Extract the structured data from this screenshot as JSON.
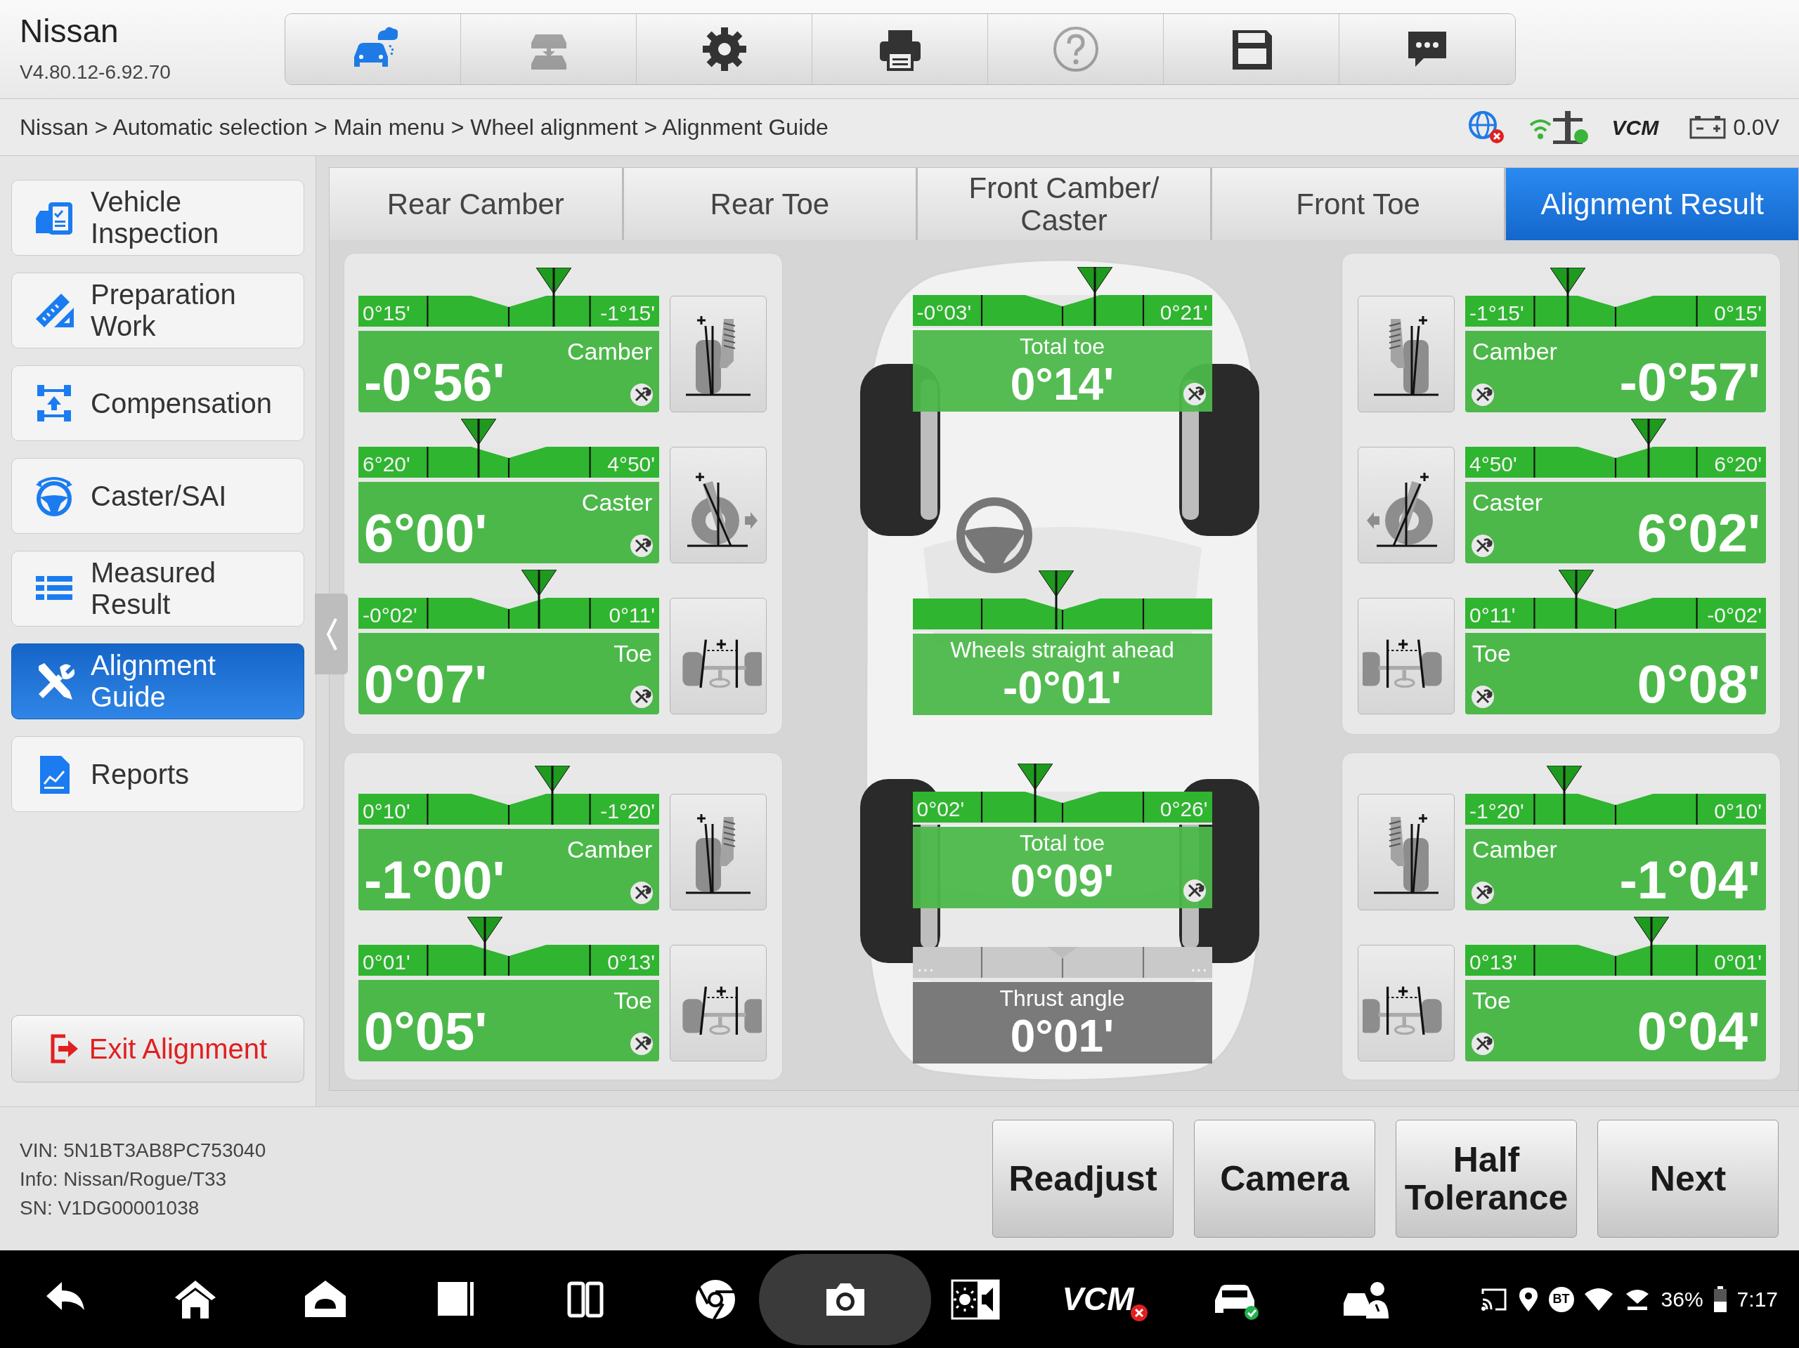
{
  "app": {
    "title": "Nissan",
    "version": "V4.80.12-6.92.70"
  },
  "toolbar": [
    {
      "kind": "car-cloud",
      "active": true,
      "disabled": false
    },
    {
      "kind": "car-lift",
      "active": false,
      "disabled": true
    },
    {
      "kind": "gear",
      "active": false,
      "disabled": false
    },
    {
      "kind": "printer",
      "active": false,
      "disabled": false
    },
    {
      "kind": "help",
      "active": false,
      "disabled": true
    },
    {
      "kind": "save",
      "active": false,
      "disabled": false
    },
    {
      "kind": "chat",
      "active": false,
      "disabled": false
    }
  ],
  "breadcrumb": "Nissan > Automatic selection > Main menu > Wheel alignment > Alignment Guide",
  "status": {
    "vcm_label": "VCM",
    "voltage": "0.0V"
  },
  "sidebar": {
    "items": [
      {
        "kind": "inspection",
        "label": "Vehicle Inspection",
        "selected": false
      },
      {
        "kind": "ruler",
        "label": "Preparation Work",
        "selected": false
      },
      {
        "kind": "compensation",
        "label": "Compensation",
        "selected": false
      },
      {
        "kind": "steering",
        "label": "Caster/SAI",
        "selected": false
      },
      {
        "kind": "list",
        "label": "Measured Result",
        "selected": false
      },
      {
        "kind": "tools",
        "label": "Alignment Guide",
        "selected": true
      },
      {
        "kind": "report",
        "label": "Reports",
        "selected": false
      }
    ],
    "exit_button": "Exit Alignment"
  },
  "tabs": [
    {
      "label": "Rear Camber",
      "selected": false
    },
    {
      "label": "Rear Toe",
      "selected": false
    },
    {
      "label": "Front Camber/ Caster",
      "selected": false
    },
    {
      "label": "Front Toe",
      "selected": false
    },
    {
      "label": "Alignment Result",
      "selected": true
    }
  ],
  "front_left": [
    {
      "kind": "camber",
      "label": "Camber",
      "value": "-0°56'",
      "left_reading": "0°15'",
      "right_reading": "-1°15'",
      "level": 0.65
    },
    {
      "kind": "caster",
      "label": "Caster",
      "value": "6°00'",
      "left_reading": "6°20'",
      "right_reading": "4°50'",
      "level": 0.4
    },
    {
      "kind": "toe",
      "label": "Toe",
      "value": "0°07'",
      "left_reading": "-0°02'",
      "right_reading": "0°11'",
      "level": 0.6
    }
  ],
  "rear_left": [
    {
      "kind": "camber",
      "label": "Camber",
      "value": "-1°00'",
      "left_reading": "0°10'",
      "right_reading": "-1°20'",
      "level": 0.645
    },
    {
      "kind": "toe",
      "label": "Toe",
      "value": "0°05'",
      "left_reading": "0°01'",
      "right_reading": "0°13'",
      "level": 0.42
    }
  ],
  "center": [
    {
      "kind": "active",
      "label": "Total toe",
      "value": "0°14'",
      "left_reading": "-0°03'",
      "right_reading": "0°21'",
      "level": 0.61,
      "adjustable": true
    },
    {
      "kind": "active",
      "label": "Wheels straight ahead",
      "value": "-0°01'",
      "level": 0.48,
      "adjustable": false
    },
    {
      "kind": "active",
      "label": "Total toe",
      "value": "0°09'",
      "left_reading": "0°02'",
      "right_reading": "0°26'",
      "level": 0.41,
      "adjustable": true
    },
    {
      "kind": "inactive",
      "label": "Thrust angle",
      "value": "0°01'",
      "left_reading": "...",
      "right_reading": "...",
      "adjustable": false
    }
  ],
  "front_right": [
    {
      "kind": "camber",
      "label": "Camber",
      "value": "-0°57'",
      "left_reading": "-1°15'",
      "right_reading": "0°15'",
      "level": 0.34
    },
    {
      "kind": "caster",
      "label": "Caster",
      "value": "6°02'",
      "left_reading": "4°50'",
      "right_reading": "6°20'",
      "level": 0.61
    },
    {
      "kind": "toe",
      "label": "Toe",
      "value": "0°08'",
      "left_reading": "0°11'",
      "right_reading": "-0°02'",
      "level": 0.37
    }
  ],
  "rear_right": [
    {
      "kind": "camber",
      "label": "Camber",
      "value": "-1°04'",
      "left_reading": "-1°20'",
      "right_reading": "0°10'",
      "level": 0.33
    },
    {
      "kind": "toe",
      "label": "Toe",
      "value": "0°04'",
      "left_reading": "0°13'",
      "right_reading": "0°01'",
      "level": 0.62
    }
  ],
  "vehicle_info": [
    "VIN: 5N1BT3AB8PC753040",
    "Info: Nissan/Rogue/T33",
    "SN: V1DG00001038"
  ],
  "buttons": [
    "Readjust",
    "Camera",
    "Half Tolerance",
    "Next"
  ],
  "taskbar": [
    {
      "kind": "back"
    },
    {
      "kind": "home"
    },
    {
      "kind": "android"
    },
    {
      "kind": "recent"
    },
    {
      "kind": "split"
    },
    {
      "kind": "browser"
    },
    {
      "kind": "camera"
    },
    {
      "kind": "brightness"
    },
    {
      "kind": "vcm",
      "label": "VCM"
    },
    {
      "kind": "car-check"
    },
    {
      "kind": "mechanic"
    }
  ],
  "tray": {
    "bt": "BT",
    "battery": "36%",
    "time": "7:17"
  }
}
